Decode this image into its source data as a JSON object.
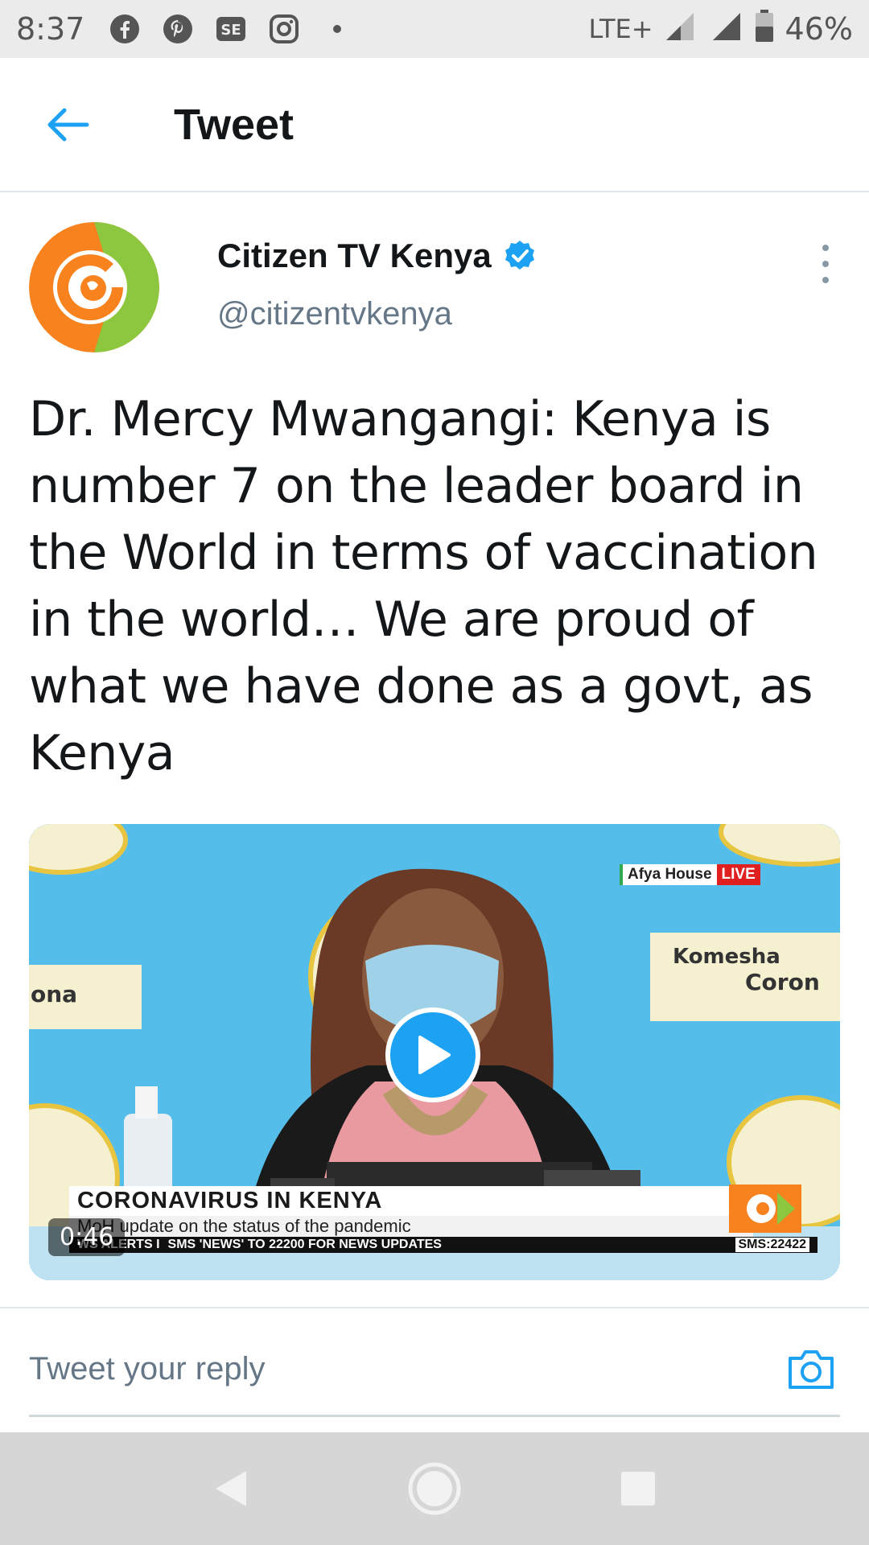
{
  "status_bar": {
    "time": "8:37",
    "icons": [
      "facebook-icon",
      "pinterest-icon",
      "se-app-icon",
      "instagram-icon",
      "notification-dot-icon"
    ],
    "network": "LTE+",
    "battery": "46%"
  },
  "header": {
    "title": "Tweet",
    "back_icon": "arrow-left-icon"
  },
  "tweet": {
    "author_name": "Citizen TV Kenya",
    "author_handle": "@citizentvkenya",
    "verified": true,
    "text": "Dr. Mercy Mwangangi: Kenya is number 7 on the leader board in the World in terms of vaccination in the world… We are proud of what we have done as a govt, as Kenya",
    "media": {
      "duration": "0:46",
      "location_tag": "Afya House",
      "live_label": "LIVE",
      "backdrop_left": "ona",
      "backdrop_right_1": "Komesha",
      "backdrop_right_2": "Coron",
      "lower_third_title": "CORONAVIRUS IN KENYA",
      "lower_third_subtitle": "MoH update on the status of the pandemic",
      "ticker_left": "WS ALERTS I",
      "ticker_main": "SMS 'NEWS' TO 22200 FOR NEWS UPDATES",
      "ticker_right": "SMS:22422"
    }
  },
  "reply": {
    "placeholder": "Tweet your reply"
  },
  "colors": {
    "accent": "#1da1f2",
    "secondary_text": "#657786",
    "brand_orange": "#f7821e",
    "brand_green": "#8dc63f"
  }
}
